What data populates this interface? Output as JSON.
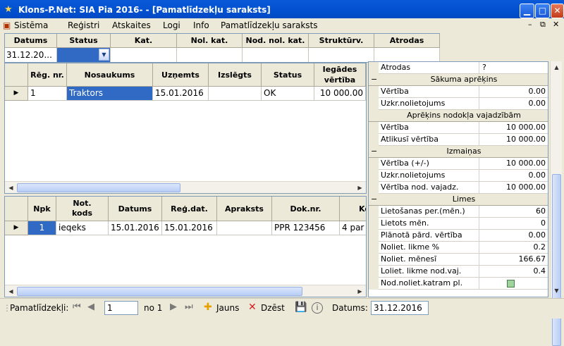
{
  "window": {
    "title": "Klons-P.Net: SIA Pia 2016- - [Pamatlīdzekļu saraksts]"
  },
  "menu": {
    "items": [
      "Sistēma",
      "Reģistri",
      "Atskaites",
      "Logi",
      "Info",
      "Pamatlīdzekļu saraksts"
    ]
  },
  "filter": {
    "columns": [
      "Datums",
      "Status",
      "Kat.",
      "Nol. kat.",
      "Nod. nol. kat.",
      "Struktūrv.",
      "Atrodas"
    ],
    "values": [
      "31.12.20...",
      "",
      "",
      "",
      "",
      "",
      ""
    ]
  },
  "assets_grid": {
    "columns": [
      "Rēg. nr.",
      "Nosaukums",
      "Uzņemts",
      "Izslēgts",
      "Status",
      "Iegādes vērtība"
    ],
    "rows": [
      [
        "1",
        "Traktors",
        "15.01.2016",
        "",
        "OK",
        "10 000.00"
      ]
    ]
  },
  "events_grid": {
    "columns": [
      "Npk",
      "Not. kods",
      "Datums",
      "Reģ.dat.",
      "Apraksts",
      "Dok.nr.",
      "Ke"
    ],
    "rows": [
      [
        "1",
        "ieqeks",
        "15.01.2016",
        "15.01.2016",
        "",
        "PPR 123456",
        "4 par"
      ]
    ]
  },
  "properties": {
    "top_row": {
      "label": "Atrodas",
      "value": "?"
    },
    "sections": [
      {
        "title": "Sākuma aprēķins",
        "expander": "−",
        "rows": [
          {
            "label": "Vērtība",
            "value": "0.00"
          },
          {
            "label": "Uzkr.nolietojums",
            "value": "0.00"
          }
        ]
      },
      {
        "title": "Aprēķins nodokļa vajadzībām",
        "expander": "",
        "rows": [
          {
            "label": "Vērtība",
            "value": "10 000.00"
          },
          {
            "label": "Atlikusī vērtība",
            "value": "10 000.00"
          }
        ]
      },
      {
        "title": "Izmaiņas",
        "expander": "−",
        "rows": [
          {
            "label": "Vērtība (+/-)",
            "value": "10 000.00"
          },
          {
            "label": "Uzkr.nolietojums",
            "value": "0.00"
          },
          {
            "label": "Vērtība nod. vajadz.",
            "value": "10 000.00"
          }
        ]
      },
      {
        "title": "Limes",
        "expander": "−",
        "rows": [
          {
            "label": "Lietošanas per.(mēn.)",
            "value": "60"
          },
          {
            "label": "Lietots mēn.",
            "value": "0"
          },
          {
            "label": "Plānotā pārd. vērtība",
            "value": "0.00"
          },
          {
            "label": "Noliet. likme %",
            "value": "0.2"
          },
          {
            "label": "Noliet. mēnesī",
            "value": "166.67"
          },
          {
            "label": "Loliet. likme nod.vaj.",
            "value": "0.4"
          },
          {
            "label": "Nod.noliet.katram pl.",
            "value": "checkbox"
          }
        ]
      }
    ]
  },
  "navigator": {
    "label": "Pamatlīdzekļi:",
    "position": "1",
    "of_label": "no 1",
    "new_label": "Jauns",
    "delete_label": "Dzēst",
    "date_label": "Datums:",
    "date_value": "31.12.2016"
  },
  "colors": {
    "title_bar": "#0352d2",
    "selection": "#316ac5",
    "chrome": "#ece9d8"
  }
}
